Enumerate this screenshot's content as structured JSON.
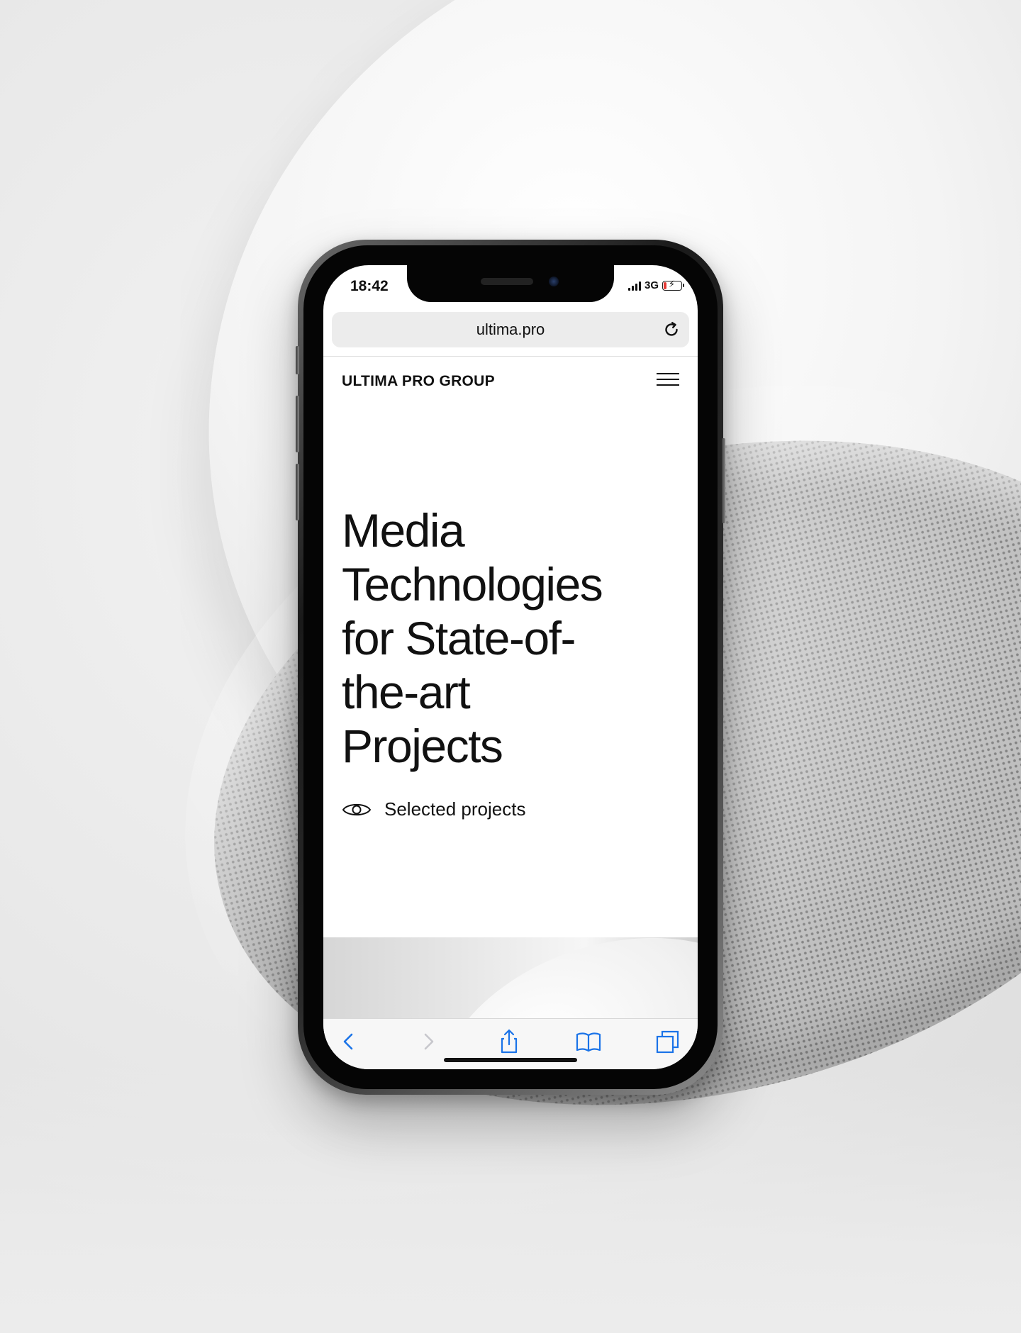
{
  "status_bar": {
    "time": "18:42",
    "network": "3G",
    "battery_level": 0.2,
    "battery_state": "charging"
  },
  "browser": {
    "url": "ultima.pro",
    "reload_icon": "reload-icon"
  },
  "site": {
    "brand": "ULTIMA PRO GROUP",
    "menu_icon": "hamburger-menu-icon",
    "hero_lines": [
      "Media",
      "Technologies",
      "for State-of-",
      "the-art",
      "Projects"
    ],
    "cta_label": "Selected projects",
    "cta_icon": "eye-icon"
  },
  "toolbar": {
    "items": [
      "back-icon",
      "forward-icon",
      "share-icon",
      "bookmarks-icon",
      "tabs-icon"
    ],
    "accent_color": "#1a73e8",
    "disabled_color": "#c7c7cc"
  }
}
